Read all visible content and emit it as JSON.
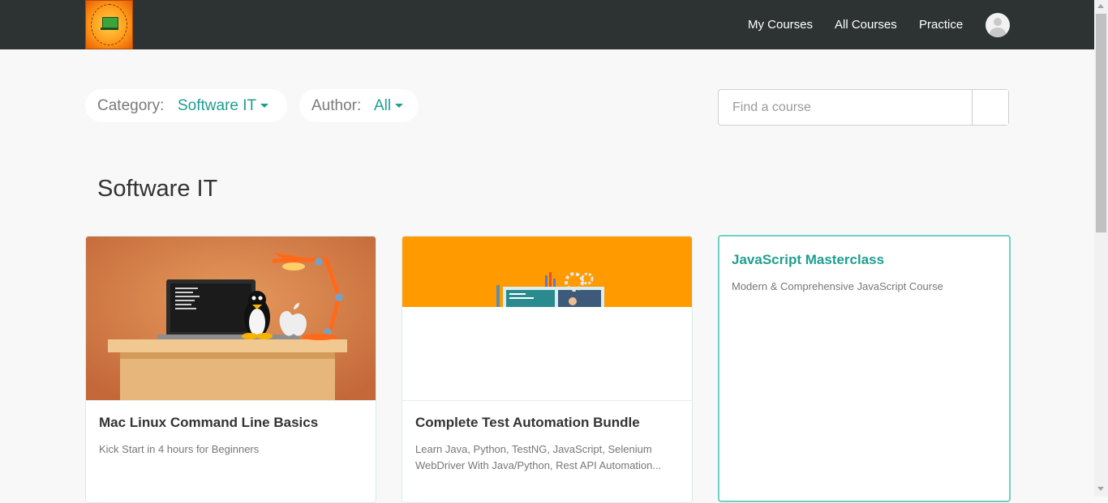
{
  "header": {
    "nav": [
      "My Courses",
      "All Courses",
      "Practice"
    ]
  },
  "filters": {
    "category_label": "Category:",
    "category_value": "Software IT",
    "author_label": "Author:",
    "author_value": "All"
  },
  "search": {
    "placeholder": "Find a course"
  },
  "page_title": "Software IT",
  "courses": [
    {
      "title": "Mac Linux Command Line Basics",
      "subtitle": "Kick Start in 4 hours for Beginners"
    },
    {
      "title": "Complete Test Automation Bundle",
      "subtitle": "Learn Java, Python, TestNG, JavaScript, Selenium WebDriver With Java/Python, Rest API Automation..."
    },
    {
      "title": "JavaScript Masterclass",
      "subtitle": "Modern & Comprehensive JavaScript Course"
    }
  ],
  "colors": {
    "header_bg": "#2d3333",
    "accent": "#1f9e92",
    "page_bg": "#f8f8f8"
  }
}
